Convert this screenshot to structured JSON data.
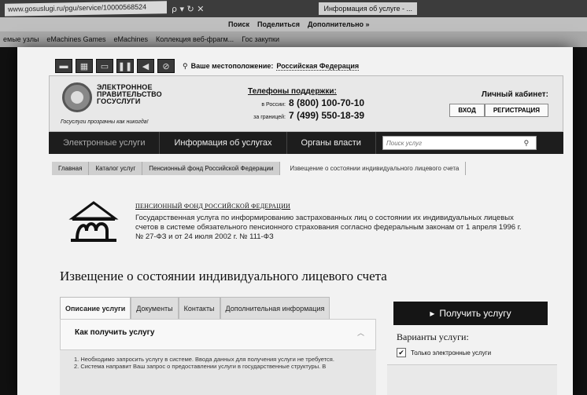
{
  "browser": {
    "address": "www.gosuslugi.ru/pgu/service/10000568524",
    "address_controls": "ρ ▾ ↻ ✕",
    "tab_title": "Информация об услуге - ...",
    "toolbar": {
      "search_label": "Поиск",
      "share_label": "Поделиться",
      "more_label": "Дополнительно »"
    },
    "favorites": [
      "емые узлы",
      "eMachines Games",
      "eMachines",
      "Коллекция веб-фрагм...",
      "Гос закупки"
    ]
  },
  "site": {
    "location_label": "Ваше местоположение:",
    "location_value": "Российская Федерация",
    "logo_line1": "ЭЛЕКТРОННОЕ",
    "logo_line2": "ПРАВИТЕЛЬСТВО",
    "logo_line3": "ГОСУСЛУГИ",
    "slogan": "Госуслуги прозрачны как никогда!",
    "support_header": "Телефоны поддержки:",
    "support_russia_label": "в России:",
    "support_russia_number": "8 (800) 100-70-10",
    "support_abroad_label": "за границей:",
    "support_abroad_number": "7 (499) 550-18-39",
    "cabinet_header": "Личный кабинет:",
    "login_label": "ВХОД",
    "register_label": "РЕГИСТРАЦИЯ"
  },
  "nav": {
    "items": [
      "Электронные услуги",
      "Информация об услугах",
      "Органы власти"
    ],
    "search_placeholder": "Поиск услуг"
  },
  "breadcrumbs": [
    "Главная",
    "Каталог услуг",
    "Пенсионный фонд Российской Федерации",
    "Извещение о состоянии индивидуального лицевого счета"
  ],
  "service": {
    "agency": "ПЕНСИОННЫЙ ФОНД РОССИЙСКОЙ ФЕДЕРАЦИИ",
    "description": "Государственная услуга по информированию застрахованных лиц о состоянии их индивидуальных лицевых счетов в системе обязательного пенсионного страхования согласно федеральным законам от 1 апреля 1996 г. № 27-ФЗ и от 24 июля 2002 г. № 111-ФЗ",
    "title": "Извещение о состоянии индивидуального лицевого счета",
    "tabs": [
      "Описание услуги",
      "Документы",
      "Контакты",
      "Дополнительная информация"
    ],
    "howto_header": "Как получить услугу",
    "step1": "1. Необходимо запросить услугу в системе. Ввода данных для получения услуги не требуется.",
    "step2": "2. Система направит Ваш запрос о предоставлении услуги в государственные структуры. В",
    "get_button": "Получить услугу",
    "variants_label": "Варианты услуги:",
    "only_electronic_label": "Только электронные услуги"
  }
}
